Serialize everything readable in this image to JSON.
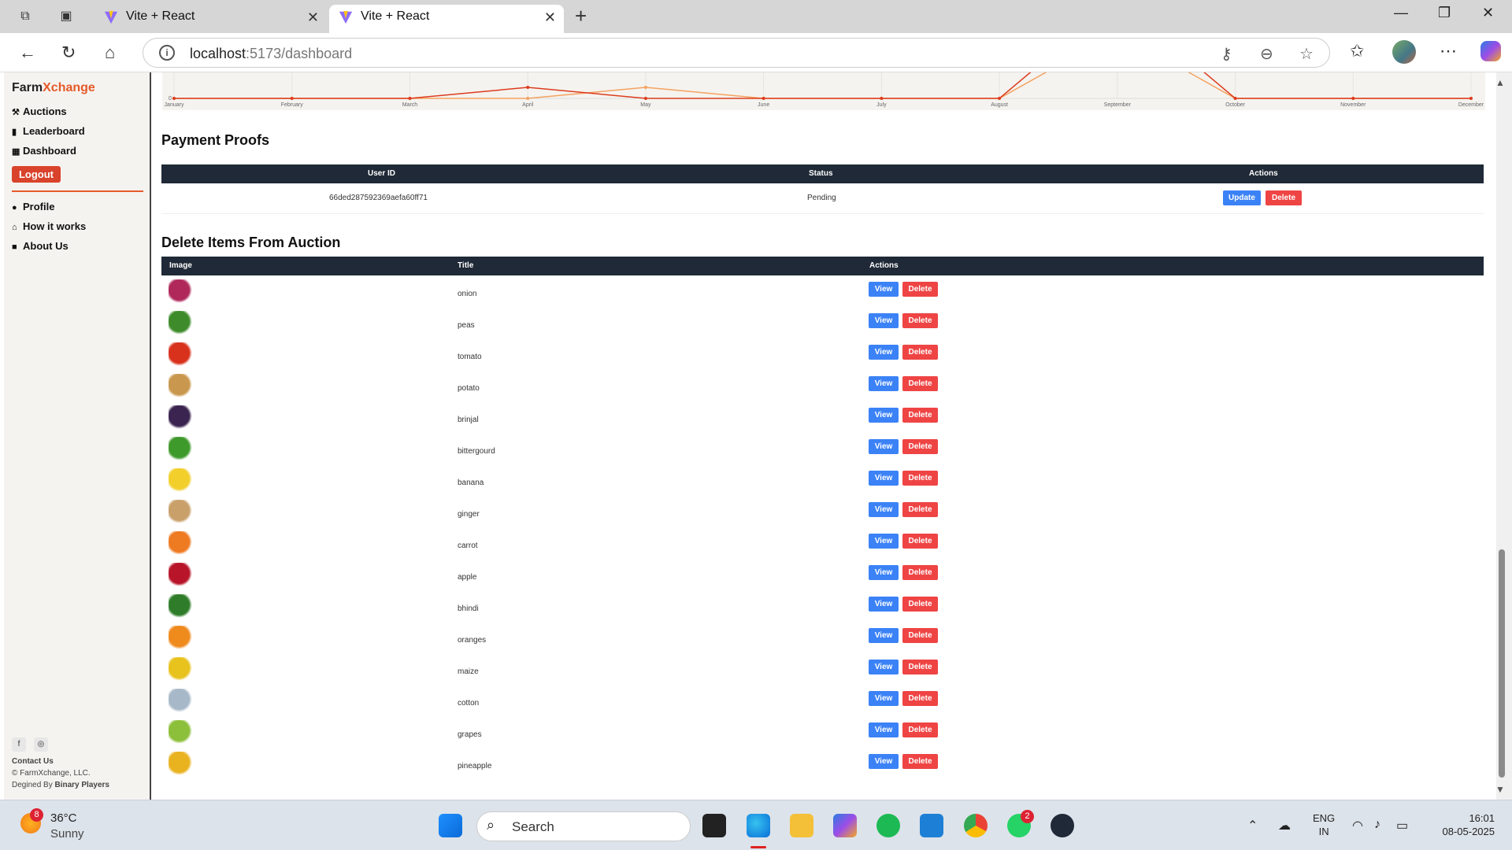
{
  "browser": {
    "tabs": [
      {
        "title": "Vite + React",
        "active": false
      },
      {
        "title": "Vite + React",
        "active": true
      }
    ],
    "url_host": "localhost",
    "url_path": ":5173/dashboard"
  },
  "sidebar": {
    "brand_part1": "Farm",
    "brand_part2": "Xchange",
    "nav": [
      {
        "label": "Auctions",
        "icon": "gavel-icon"
      },
      {
        "label": "Leaderboard",
        "icon": "bar-chart-icon"
      },
      {
        "label": "Dashboard",
        "icon": "grid-icon"
      }
    ],
    "logout_label": "Logout",
    "secondary": [
      {
        "label": "Profile",
        "icon": "user-circle-icon"
      },
      {
        "label": "How it works",
        "icon": "garage-icon"
      },
      {
        "label": "About Us",
        "icon": "info-square-icon"
      }
    ],
    "contact": "Contact Us",
    "copyright": "© FarmXchange, LLC.",
    "designed_prefix": "Degined By ",
    "designed_by": "Binary Players"
  },
  "chart_data": {
    "type": "line",
    "categories": [
      "January",
      "February",
      "March",
      "April",
      "May",
      "June",
      "July",
      "August",
      "September",
      "October",
      "November",
      "December"
    ],
    "y_tick_visible": "0",
    "series": [
      {
        "color": "#dc3c1e",
        "values": [
          0,
          0,
          0,
          1,
          0,
          0,
          0,
          0,
          9,
          0,
          0,
          0
        ]
      },
      {
        "color": "#f4a261",
        "values": [
          0,
          0,
          0,
          0,
          1,
          0,
          0,
          0,
          6,
          0,
          0,
          0
        ]
      }
    ]
  },
  "payment_proofs": {
    "title": "Payment Proofs",
    "headers": [
      "User ID",
      "Status",
      "Actions"
    ],
    "rows": [
      {
        "user_id": "66ded287592369aefa60ff71",
        "status": "Pending",
        "update_label": "Update",
        "delete_label": "Delete"
      }
    ]
  },
  "delete_items": {
    "title": "Delete Items From Auction",
    "headers": [
      "Image",
      "Title",
      "Actions"
    ],
    "view_label": "View",
    "delete_label": "Delete",
    "items": [
      {
        "title": "onion",
        "color": "#b0285a"
      },
      {
        "title": "peas",
        "color": "#3d8b2a"
      },
      {
        "title": "tomato",
        "color": "#d8311c"
      },
      {
        "title": "potato",
        "color": "#c9974d"
      },
      {
        "title": "brinjal",
        "color": "#3b2450"
      },
      {
        "title": "bittergourd",
        "color": "#3f9a2c"
      },
      {
        "title": "banana",
        "color": "#f2cf2a"
      },
      {
        "title": "ginger",
        "color": "#c9a06a"
      },
      {
        "title": "carrot",
        "color": "#ee7a22"
      },
      {
        "title": "apple",
        "color": "#b8152a"
      },
      {
        "title": "bhindi",
        "color": "#2f7d2a"
      },
      {
        "title": "oranges",
        "color": "#ef8a1c"
      },
      {
        "title": "maize",
        "color": "#e8c21d"
      },
      {
        "title": "cotton",
        "color": "#a7b9c9"
      },
      {
        "title": "grapes",
        "color": "#8cbf3a"
      },
      {
        "title": "pineapple",
        "color": "#e9b21f"
      }
    ]
  },
  "taskbar": {
    "weather_badge": "8",
    "temperature": "36°C",
    "condition": "Sunny",
    "search_label": "Search",
    "whatsapp_badge": "2",
    "lang_line1": "ENG",
    "lang_line2": "IN",
    "time": "16:01",
    "date": "08-05-2025"
  }
}
